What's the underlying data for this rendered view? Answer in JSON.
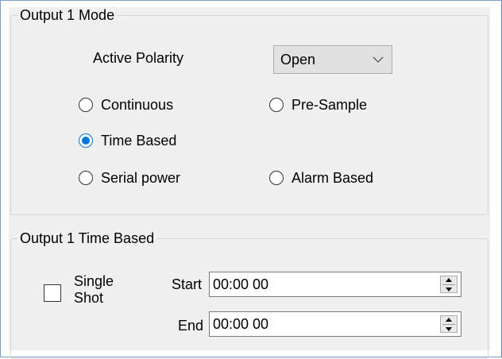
{
  "mode_group": {
    "title": "Output 1 Mode",
    "active_polarity_label": "Active Polarity",
    "polarity_selected": "Open",
    "options": [
      {
        "id": "continuous",
        "label": "Continuous",
        "checked": false
      },
      {
        "id": "pre_sample",
        "label": "Pre-Sample",
        "checked": false
      },
      {
        "id": "time_based",
        "label": "Time Based",
        "checked": true
      },
      {
        "id": "serial_power",
        "label": "Serial power",
        "checked": false
      },
      {
        "id": "alarm_based",
        "label": "Alarm Based",
        "checked": false
      }
    ]
  },
  "time_group": {
    "title": "Output 1 Time Based",
    "single_shot_label_line1": "Single",
    "single_shot_label_line2": "Shot",
    "single_shot_checked": false,
    "start_label": "Start",
    "start_value": "00:00 00",
    "end_label": "End",
    "end_value": "00:00 00"
  },
  "colors": {
    "accent": "#0078d7",
    "panel_bg": "#f0f0f0",
    "frame_border": "#7a9ec8"
  },
  "icons": {
    "dropdown": "chevron-down-icon",
    "spinner": "spin-updown-icon"
  }
}
